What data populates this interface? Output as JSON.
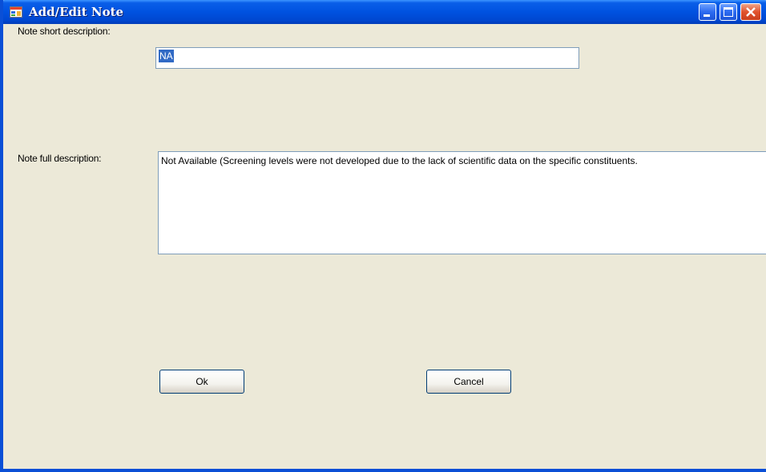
{
  "window": {
    "title": "Add/Edit Note",
    "icon": "app-form-icon",
    "controls": [
      "minimize-icon",
      "maximize-icon",
      "close-icon"
    ]
  },
  "form": {
    "short_label": "Note short description:",
    "short_value": "NA",
    "full_label": "Note full description:",
    "full_value": "Not Available (Screening levels were not developed due to the lack of scientific data on the specific constituents."
  },
  "buttons": {
    "ok": "Ok",
    "cancel": "Cancel"
  },
  "colors": {
    "titlebar": "#0052E0",
    "face": "#ECE9D8",
    "selection": "#316AC5"
  }
}
